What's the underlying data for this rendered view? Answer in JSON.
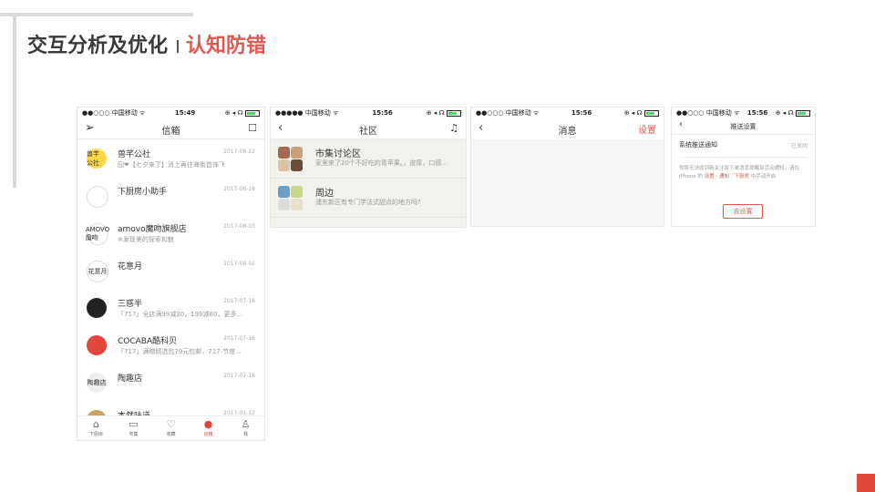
{
  "slide": {
    "title": "交互分析及优化",
    "subtitle": "认知防错",
    "accent": "#e2463b"
  },
  "phone1": {
    "status": {
      "carrier": "●●○○○ 中国移动 ᯤ",
      "time": "15:49",
      "icons": "⊕ ◂ ☊"
    },
    "nav": {
      "title": "信箱",
      "left_icon": "send-icon",
      "right_icon": "chat-icon"
    },
    "rows": [
      {
        "name": "兽芊公社",
        "date": "2017-08-22",
        "preview": "囧❤【七夕来了】消上再往海街首饰飞",
        "avatar": "兽芊\n公社",
        "avatar_bg": "#ffd84a"
      },
      {
        "name": "下厨房小助手",
        "date": "2017-06-18",
        "preview": "",
        "avatar": "",
        "avatar_bg": "#ffffff"
      },
      {
        "name": "amovo魔吻旗舰店",
        "date": "2017-08-03",
        "preview": "※发现美的探索和魅",
        "avatar": "AMOVO\n魔吻",
        "avatar_bg": "#ffffff"
      },
      {
        "name": "花意月",
        "date": "2017-08-02",
        "preview": "",
        "avatar": "花意月",
        "avatar_bg": "#ffffff"
      },
      {
        "name": "三惑半",
        "date": "2017-07-16",
        "preview": "「717」全店满99减30，199减60，更多...",
        "avatar": "",
        "avatar_bg": "#222222"
      },
      {
        "name": "COCABA酷科贝",
        "date": "2017-07-16",
        "preview": "「717」满赠精选包79元包邮，717-节度...",
        "avatar": "",
        "avatar_bg": "#e2463b"
      },
      {
        "name": "陶趣店",
        "date": "2017-02-16",
        "preview": "",
        "avatar": "陶趣店",
        "avatar_bg": "#eeeeee"
      },
      {
        "name": "本然味道",
        "date": "2017-01-12",
        "preview": "",
        "avatar": "",
        "avatar_bg": "#c9a35c"
      }
    ],
    "tabs": [
      {
        "label": "下厨房",
        "icon": "home-icon",
        "glyph": "⌂",
        "active": false
      },
      {
        "label": "市集",
        "icon": "shop-icon",
        "glyph": "▭",
        "active": false
      },
      {
        "label": "收藏",
        "icon": "heart-icon",
        "glyph": "♡",
        "active": false
      },
      {
        "label": "信箱",
        "icon": "mail-icon",
        "glyph": "●",
        "active": true
      },
      {
        "label": "我",
        "icon": "user-icon",
        "glyph": "♙",
        "active": false
      }
    ]
  },
  "phone2": {
    "status": {
      "carrier": "●●●●● 中国移动 ᯤ",
      "time": "15:56",
      "icons": "⊕ ◂ ☊"
    },
    "nav": {
      "title": "社区",
      "left_icon": "back-icon",
      "right_icon": "bell-icon"
    },
    "rows": [
      {
        "name": "市集讨论区",
        "preview": "家里来了20个不好吃的青苹果。，皮厚，口感..."
      },
      {
        "name": "周边",
        "preview": "浦东新区有专门学法式甜点的地方吗?"
      }
    ]
  },
  "phone3": {
    "status": {
      "carrier": "●●○○○ 中国移动 ᯤ",
      "time": "15:56",
      "icons": "⊕ ◂ ☊"
    },
    "nav": {
      "title": "消息",
      "right_label": "设置",
      "left_icon": "back-icon"
    }
  },
  "phone4": {
    "status": {
      "carrier": "●●○○○ 中国移动 ᯤ",
      "time": "15:56",
      "icons": "⊕ ◂ ☊"
    },
    "nav": {
      "title": "推送设置",
      "left_icon": "back-icon"
    },
    "setting": {
      "label": "系统推送通知",
      "value": "已关闭"
    },
    "note_prefix": "你将无法收到新关注及下单消息提醒及活动通知。请在 iPhone 的",
    "note_path": "设置 - 通知 - 下厨房",
    "note_suffix": "中手动开启",
    "button": "去设置"
  }
}
